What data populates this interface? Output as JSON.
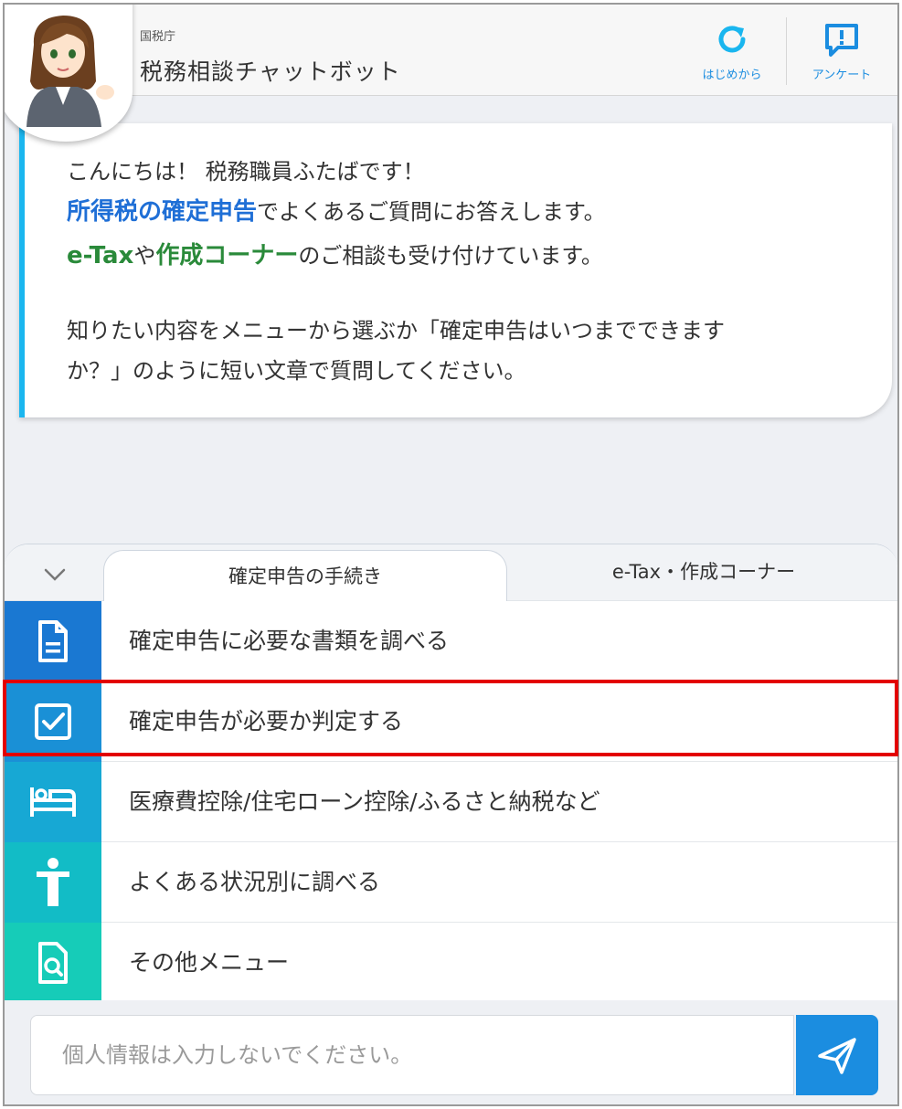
{
  "header": {
    "agency": "国税庁",
    "title": "税務相談チャットボット",
    "restart_label": "はじめから",
    "survey_label": "アンケート"
  },
  "message": {
    "line1": "こんにちは！ 税務職員ふたばです！",
    "line2_highlight": "所得税の確定申告",
    "line2_rest": "でよくあるご質問にお答えします。",
    "line3_hl1": "e-Tax",
    "line3_mid": "や",
    "line3_hl2": "作成コーナー",
    "line3_rest": "のご相談も受け付けています。",
    "line4": "知りたい内容をメニューから選ぶか「確定申告はいつまでできます",
    "line5": "か？」のように短い文章で質問してください。"
  },
  "tabs": {
    "active": "確定申告の手続き",
    "inactive": "e-Tax・作成コーナー"
  },
  "menu": {
    "items": [
      {
        "label": "確定申告に必要な書類を調べる",
        "icon": "document-icon",
        "color": "#1a78d2"
      },
      {
        "label": "確定申告が必要か判定する",
        "icon": "checkbox-icon",
        "color": "#1a90d6"
      },
      {
        "label": "医療費控除/住宅ローン控除/ふるさと納税など",
        "icon": "bed-icon",
        "color": "#17a8d4"
      },
      {
        "label": "よくある状況別に調べる",
        "icon": "person-icon",
        "color": "#12bcc6"
      },
      {
        "label": "その他メニュー",
        "icon": "search-document-icon",
        "color": "#16ccb8"
      }
    ]
  },
  "input": {
    "placeholder": "個人情報は入力しないでください。"
  },
  "colors": {
    "accent": "#1b8de0",
    "highlight_box": "#e30000"
  }
}
